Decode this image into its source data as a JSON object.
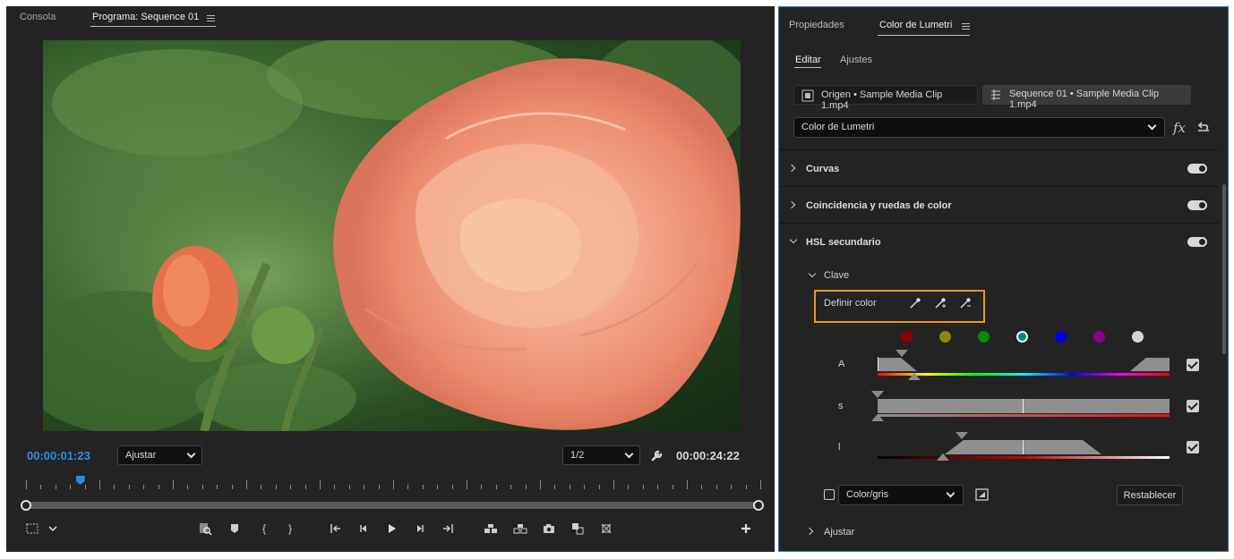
{
  "monitor": {
    "tabs": {
      "consola": "Consola",
      "program": "Programa: Sequence 01"
    },
    "current_time": "00:00:01:23",
    "fit": "Ajustar",
    "resolution": "1/2",
    "duration": "00:00:24:22",
    "playhead_fraction": 0.074
  },
  "lumetri": {
    "tabs": {
      "properties": "Propiedades",
      "lumetri": "Color de Lumetri"
    },
    "subtabs": {
      "edit": "Editar",
      "settings": "Ajustes"
    },
    "clips": {
      "source": "Origen • Sample Media Clip 1.mp4",
      "sequence": "Sequence 01 • Sample Media Clip 1.mp4"
    },
    "effect": "Color de Lumetri",
    "sections": {
      "curves": "Curvas",
      "wheels": "Coincidencia y ruedas de color",
      "hsl": "HSL secundario"
    },
    "key": "Clave",
    "set_color": "Definir color",
    "swatches": [
      "#8b0000",
      "#8b8b00",
      "#008b00",
      "#008b8b",
      "#0000ee",
      "#8b008b",
      "#d8d0d8"
    ],
    "selected_swatch": 3,
    "sliders": {
      "h": "A",
      "s": "s",
      "l": "l"
    },
    "view_mode": "Color/gris",
    "reset": "Restablecer",
    "refine": "Ajustar"
  }
}
